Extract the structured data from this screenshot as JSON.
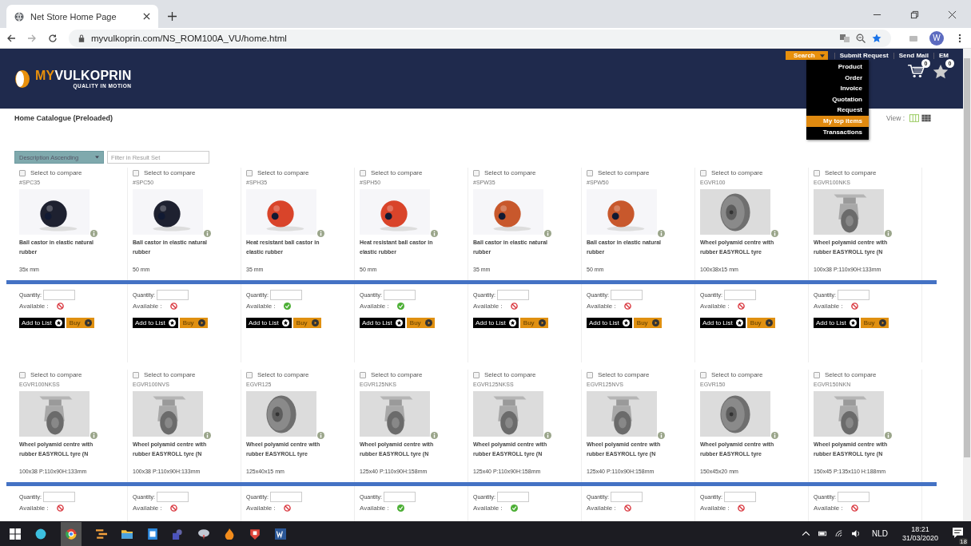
{
  "browser": {
    "tab_title": "Net Store Home Page",
    "url": "myvulkoprin.com/NS_ROM100A_VU/home.html",
    "profile": "W"
  },
  "header": {
    "logo_prefix": "MY",
    "logo_name": "VULKOPRIN",
    "tagline": "QUALITY IN MOTION",
    "links": [
      {
        "label": "Search",
        "kind": "dropdown"
      },
      {
        "label": "Submit Request",
        "kind": "link"
      },
      {
        "label": "Send Mail",
        "kind": "link"
      },
      {
        "label": "EM",
        "kind": "link"
      }
    ],
    "cart_count": "0",
    "favorites_count": "0",
    "menu": [
      {
        "label": "Product",
        "selected": false
      },
      {
        "label": "Order",
        "selected": false
      },
      {
        "label": "Invoice",
        "selected": false
      },
      {
        "label": "Quotation",
        "selected": false
      },
      {
        "label": "Request",
        "selected": false
      },
      {
        "label": "My top items",
        "selected": true
      },
      {
        "label": "Transactions",
        "selected": false
      }
    ]
  },
  "page_title": "Home Catalogue (Preloaded)",
  "view_label": "View :",
  "sort": {
    "value": "Description Ascending"
  },
  "filter": {
    "placeholder": "Filter in Result Set"
  },
  "product_rows": [
    {
      "products": [
        {
          "compare_label": "Select to compare",
          "checked": false,
          "code": "#SPC35",
          "kind": "black-ball",
          "description": "Ball castor in elastic natural rubber",
          "size": "35x mm",
          "quantity_label": "Quantity:",
          "available_label": "Available :",
          "available": false,
          "add_label": "Add to List",
          "buy_label": "Buy"
        },
        {
          "compare_label": "Select to compare",
          "checked": false,
          "code": "#SPC50",
          "kind": "black-ball",
          "description": "Ball castor in elastic natural rubber",
          "size": "50 mm",
          "quantity_label": "Quantity:",
          "available_label": "Available :",
          "available": false,
          "add_label": "Add to List",
          "buy_label": "Buy"
        },
        {
          "compare_label": "Select to compare",
          "checked": false,
          "code": "#SPH35",
          "kind": "red-ball",
          "description": "Heat resistant ball castor in elastic rubber",
          "size": "35 mm",
          "quantity_label": "Quantity:",
          "available_label": "Available :",
          "available": true,
          "add_label": "Add to List",
          "buy_label": "Buy"
        },
        {
          "compare_label": "Select to compare",
          "checked": false,
          "code": "#SPH50",
          "kind": "red-ball",
          "description": "Heat resistant ball castor in elastic rubber",
          "size": "50 mm",
          "quantity_label": "Quantity:",
          "available_label": "Available :",
          "available": true,
          "add_label": "Add to List",
          "buy_label": "Buy"
        },
        {
          "compare_label": "Select to compare",
          "checked": false,
          "code": "#SPW35",
          "kind": "orange-ball",
          "description": "Ball castor in elastic natural rubber",
          "size": "35 mm",
          "quantity_label": "Quantity:",
          "available_label": "Available :",
          "available": false,
          "add_label": "Add to List",
          "buy_label": "Buy"
        },
        {
          "compare_label": "Select to compare",
          "checked": false,
          "code": "#SPW50",
          "kind": "orange-ball",
          "description": "Ball castor in elastic natural rubber",
          "size": "50 mm",
          "quantity_label": "Quantity:",
          "available_label": "Available :",
          "available": false,
          "add_label": "Add to List",
          "buy_label": "Buy"
        },
        {
          "compare_label": "Select to compare",
          "checked": false,
          "code": "EGVR100",
          "kind": "wheel",
          "description": "Wheel polyamid centre with rubber EASYROLL tyre",
          "size": "100x38x15 mm",
          "quantity_label": "Quantity:",
          "available_label": "Available :",
          "available": false,
          "add_label": "Add to List",
          "buy_label": "Buy"
        },
        {
          "compare_label": "Select to compare",
          "checked": false,
          "code": "EGVR100NKS",
          "kind": "castor",
          "description": "Wheel polyamid centre with rubber EASYROLL tyre (N",
          "size": "100x38 P:110x90H:133mm",
          "quantity_label": "Quantity:",
          "available_label": "Available :",
          "available": false,
          "add_label": "Add to List",
          "buy_label": "Buy"
        }
      ]
    },
    {
      "products": [
        {
          "compare_label": "Select to compare",
          "checked": false,
          "code": "EGVR100NKSS",
          "kind": "castor",
          "description": "Wheel polyamid centre with rubber EASYROLL tyre (N",
          "size": "100x38 P:110x90H:133mm",
          "quantity_label": "Quantity:",
          "available_label": "Available :",
          "available": false
        },
        {
          "compare_label": "Select to compare",
          "checked": false,
          "code": "EGVR100NVS",
          "kind": "castor",
          "description": "Wheel polyamid centre with rubber EASYROLL tyre (N",
          "size": "100x38 P:110x90H:133mm",
          "quantity_label": "Quantity:",
          "available_label": "Available :",
          "available": false
        },
        {
          "compare_label": "Select to compare",
          "checked": false,
          "code": "EGVR125",
          "kind": "wheel",
          "description": "Wheel polyamid centre with rubber EASYROLL tyre",
          "size": "125x40x15 mm",
          "quantity_label": "Quantity:",
          "available_label": "Available :",
          "available": false
        },
        {
          "compare_label": "Select to compare",
          "checked": false,
          "code": "EGVR125NKS",
          "kind": "castor",
          "description": "Wheel polyamid centre with rubber EASYROLL tyre (N",
          "size": "125x40 P:110x90H:158mm",
          "quantity_label": "Quantity:",
          "available_label": "Available :",
          "available": true
        },
        {
          "compare_label": "Select to compare",
          "checked": false,
          "code": "EGVR125NKSS",
          "kind": "castor",
          "description": "Wheel polyamid centre with rubber EASYROLL tyre (N",
          "size": "125x40 P:110x90H:158mm",
          "quantity_label": "Quantity:",
          "available_label": "Available :",
          "available": true
        },
        {
          "compare_label": "Select to compare",
          "checked": false,
          "code": "EGVR125NVS",
          "kind": "castor",
          "description": "Wheel polyamid centre with rubber EASYROLL tyre (N",
          "size": "125x40 P:110x90H:158mm",
          "quantity_label": "Quantity:",
          "available_label": "Available :",
          "available": false
        },
        {
          "compare_label": "Select to compare",
          "checked": false,
          "code": "EGVR150",
          "kind": "wheel",
          "description": "Wheel polyamid centre with rubber EASYROLL tyre",
          "size": "150x45x20 mm",
          "quantity_label": "Quantity:",
          "available_label": "Available :",
          "available": false
        },
        {
          "compare_label": "Select to compare",
          "checked": false,
          "code": "EGVR150NKN",
          "kind": "castor",
          "description": "Wheel polyamid centre with rubber EASYROLL tyre (N",
          "size": "150x45 P:135x110 H:188mm",
          "quantity_label": "Quantity:",
          "available_label": "Available :",
          "available": false
        }
      ]
    }
  ],
  "taskbar": {
    "language": "NLD",
    "time": "18:21",
    "date": "31/03/2020",
    "notifications": "18"
  }
}
